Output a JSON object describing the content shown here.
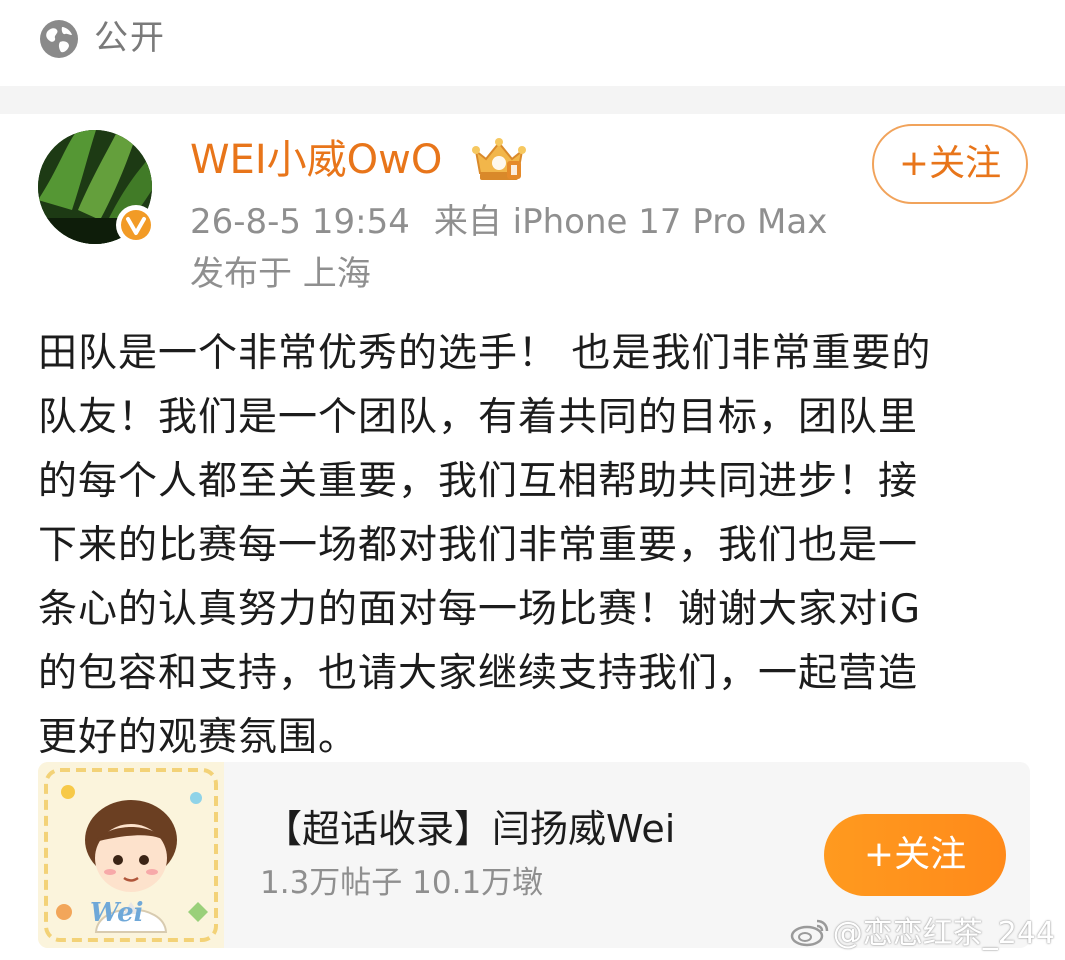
{
  "visibility": {
    "icon": "globe-icon",
    "label": "公开"
  },
  "post": {
    "author": "WEI小威OwO",
    "author_color": "#e8751a",
    "badge_icon": "crown-badge-icon",
    "verified_icon": "verified-v-icon",
    "follow_label": "+关注",
    "time": "26-8-5 19:54",
    "source": "来自 iPhone 17 Pro Max",
    "location": "发布于 上海",
    "body_lines": [
      "田队是一个非常优秀的选手！ 也是我们非常重要的",
      "队友！我们是一个团队，有着共同的目标，团队里",
      "的每个人都至关重要，我们互相帮助共同进步！接",
      "下来的比赛每一场都对我们非常重要，我们也是一",
      "条心的认真努力的面对每一场比赛！谢谢大家对iG",
      "的包容和支持，也请大家继续支持我们，一起营造",
      "更好的观赛氛围。"
    ]
  },
  "topic_card": {
    "title": "【超话收录】闫扬威Wei",
    "stats": "1.3万帖子 10.1万墩",
    "follow_label": "+关注",
    "follow_color": "#ff8f1c",
    "thumb_text": "Wei"
  },
  "watermark": {
    "icon": "weibo-logo-icon",
    "text": "@恋恋红茶_244"
  }
}
